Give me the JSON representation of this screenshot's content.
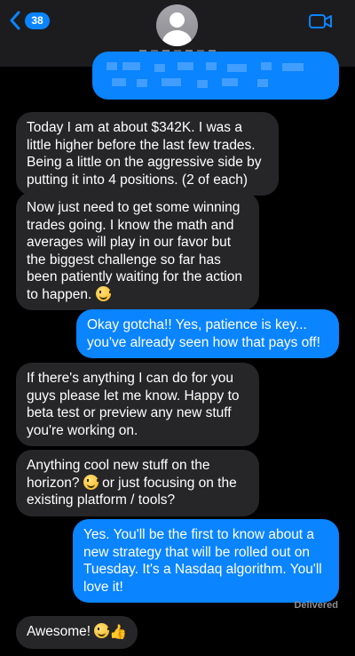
{
  "header": {
    "back_badge": "38",
    "icons": {
      "back": "chevron-left-icon",
      "video": "video-camera-icon",
      "avatar": "person-icon"
    },
    "accent_color": "#0a84ff"
  },
  "messages": [
    {
      "direction": "received",
      "text": "Today I am at about $342K. I was a little higher before the last few trades. Being a little on the aggressive side by putting it into 4 positions. (2 of each)"
    },
    {
      "direction": "received",
      "text": "Now just need to get some winning trades going. I know the math and averages will play in our favor but the biggest challenge so far has been patiently waiting for the action to happen. ",
      "emoji": "slightly-smiling-face"
    },
    {
      "direction": "sent",
      "text": "Okay gotcha!! Yes, patience is key... you've already seen how that pays off!"
    },
    {
      "direction": "received",
      "text": "If there's anything I can do for you guys please let me know. Happy to beta test or preview any new stuff you're working on."
    },
    {
      "direction": "received",
      "text_a": "Anything cool new stuff on the horizon? ",
      "emoji": "slightly-smiling-face",
      "text_b": " or just focusing on the existing platform / tools?"
    },
    {
      "direction": "sent",
      "text": "Yes. You'll be the first to know about a new strategy that will be rolled out on Tuesday. It's a Nasdaq algorithm. You'll love it!"
    },
    {
      "direction": "received",
      "text": "Awesome! ",
      "emoji": "grinning-face",
      "emoji2": "thumbs-up"
    }
  ],
  "status": {
    "delivered": "Delivered"
  }
}
